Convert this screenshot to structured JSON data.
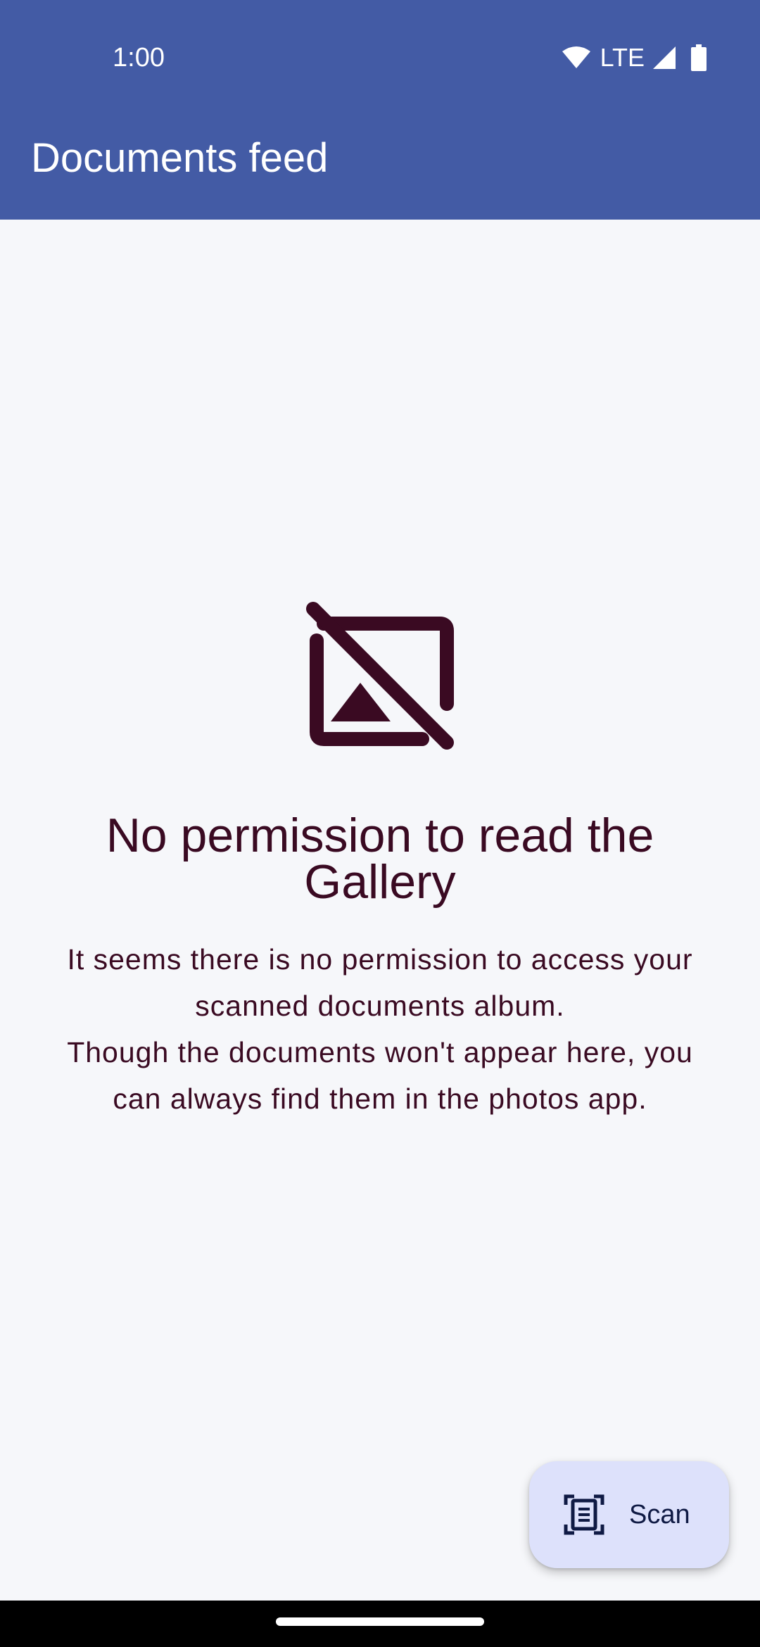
{
  "status_bar": {
    "time": "1:00",
    "network": "LTE",
    "icons": [
      "wifi-icon",
      "cell-signal-icon",
      "battery-icon"
    ]
  },
  "toolbar": {
    "title": "Documents feed"
  },
  "empty_state": {
    "icon": "hide-image-icon",
    "title": "No permission to read the Gallery",
    "body_lines": [
      "It seems there is no permission to access your",
      "scanned documents album.",
      "Though the documents won't appear here, you",
      "can always find them in the photos app."
    ]
  },
  "fab": {
    "label": "Scan",
    "icon": "document-scanner-icon"
  },
  "colors": {
    "app_bar": "#435ba5",
    "background": "#f6f7fa",
    "text_primary": "#3a0a22",
    "fab_background": "#dde1fb",
    "fab_text": "#0f1a44"
  }
}
